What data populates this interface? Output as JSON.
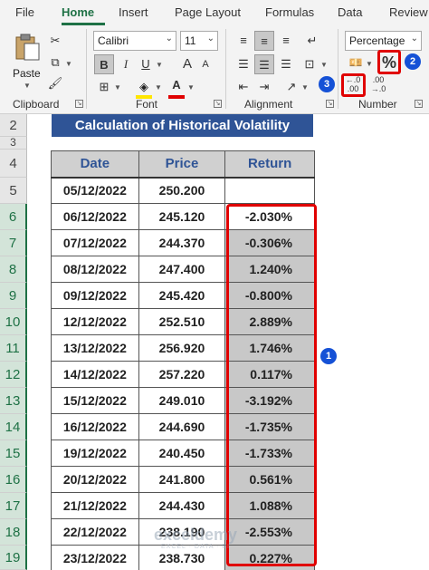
{
  "ribbon": {
    "tabs": [
      "File",
      "Home",
      "Insert",
      "Page Layout",
      "Formulas",
      "Data",
      "Review"
    ],
    "active_tab": "Home",
    "clipboard": {
      "paste_label": "Paste",
      "group_label": "Clipboard"
    },
    "font": {
      "name": "Calibri",
      "size": "11",
      "bold": "B",
      "italic": "I",
      "underline": "U",
      "grow": "A",
      "shrink": "A",
      "color_letter": "A",
      "group_label": "Font"
    },
    "alignment": {
      "group_label": "Alignment"
    },
    "number": {
      "format": "Percentage",
      "percent": "%",
      "increase_decimal": "←.0 .00",
      "decrease_decimal": ".00 →.0",
      "group_label": "Number"
    },
    "badges": {
      "b1": "1",
      "b2": "2",
      "b3": "3"
    }
  },
  "sheet": {
    "title": "Calculation of Historical Volatility",
    "row_numbers": [
      "2",
      "3",
      "4",
      "5",
      "6",
      "7",
      "8",
      "9",
      "10",
      "11",
      "12",
      "13",
      "14",
      "15",
      "16",
      "17",
      "18",
      "19"
    ],
    "headers": [
      "Date",
      "Price",
      "Return"
    ],
    "rows": [
      {
        "date": "05/12/2022",
        "price": "250.200",
        "ret": ""
      },
      {
        "date": "06/12/2022",
        "price": "245.120",
        "ret": "-2.030%"
      },
      {
        "date": "07/12/2022",
        "price": "244.370",
        "ret": "-0.306%"
      },
      {
        "date": "08/12/2022",
        "price": "247.400",
        "ret": "1.240%"
      },
      {
        "date": "09/12/2022",
        "price": "245.420",
        "ret": "-0.800%"
      },
      {
        "date": "12/12/2022",
        "price": "252.510",
        "ret": "2.889%"
      },
      {
        "date": "13/12/2022",
        "price": "256.920",
        "ret": "1.746%"
      },
      {
        "date": "14/12/2022",
        "price": "257.220",
        "ret": "0.117%"
      },
      {
        "date": "15/12/2022",
        "price": "249.010",
        "ret": "-3.192%"
      },
      {
        "date": "16/12/2022",
        "price": "244.690",
        "ret": "-1.735%"
      },
      {
        "date": "19/12/2022",
        "price": "240.450",
        "ret": "-1.733%"
      },
      {
        "date": "20/12/2022",
        "price": "241.800",
        "ret": "0.561%"
      },
      {
        "date": "21/12/2022",
        "price": "244.430",
        "ret": "1.088%"
      },
      {
        "date": "22/12/2022",
        "price": "238.190",
        "ret": "-2.553%"
      },
      {
        "date": "23/12/2022",
        "price": "238.730",
        "ret": "0.227%"
      }
    ]
  },
  "watermark": {
    "text": "exceldemy",
    "sub": "EXCEL · DATA · BI"
  }
}
